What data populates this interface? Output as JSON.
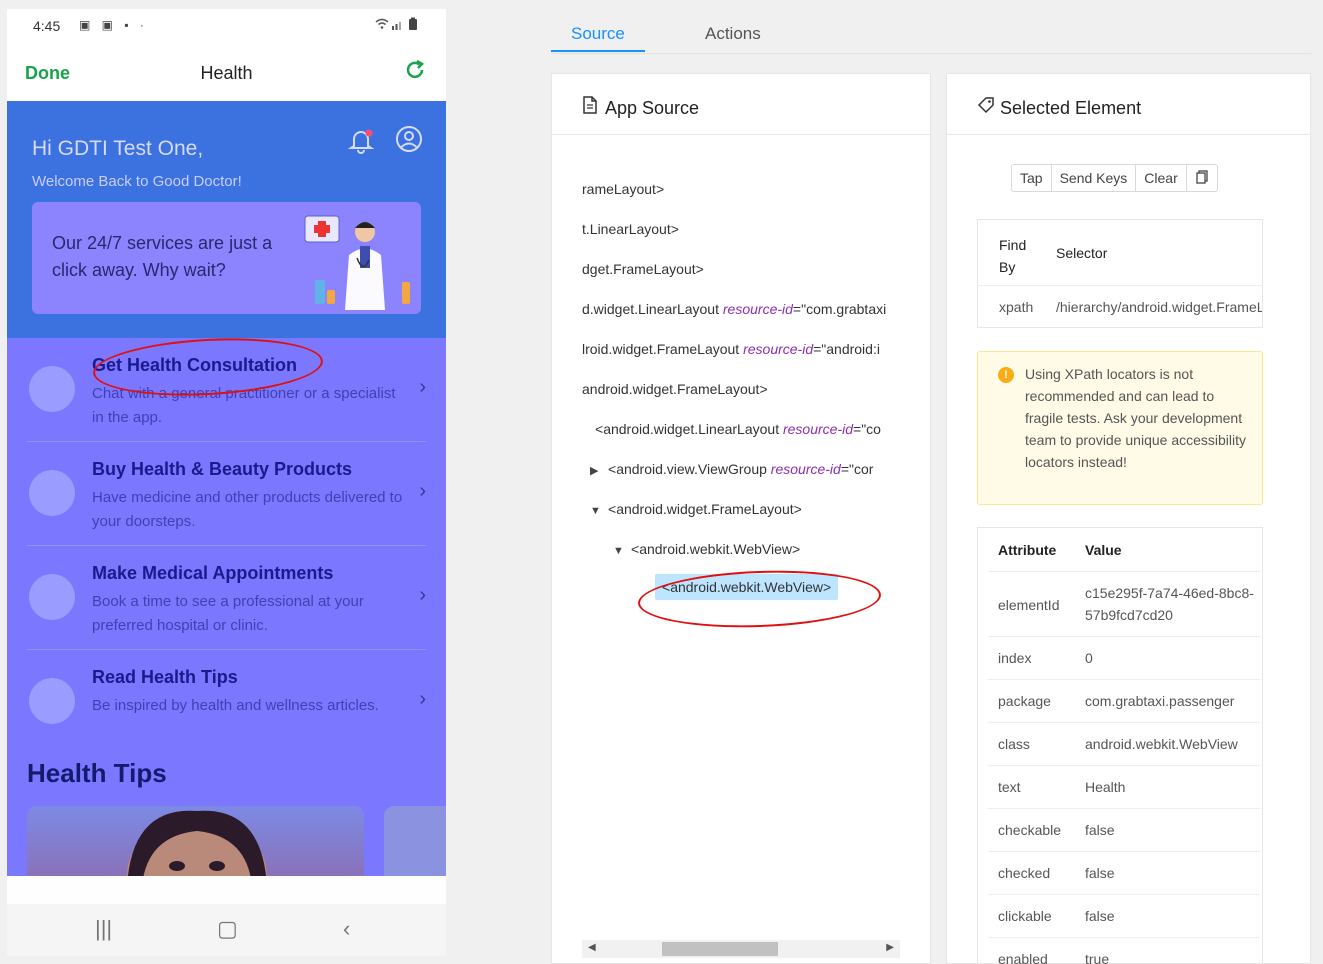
{
  "phone": {
    "status_time": "4:45",
    "nav": {
      "done": "Done",
      "title": "Health"
    },
    "hero": {
      "greeting": "Hi GDTI Test One,",
      "welcome": "Welcome Back to Good Doctor!",
      "promo": "Our 24/7 services are just a click away. Why wait?"
    },
    "services": [
      {
        "title": "Get Health Consultation",
        "desc": "Chat with a general practitioner or a specialist in the app."
      },
      {
        "title": "Buy Health & Beauty Products",
        "desc": "Have medicine and other products delivered to your doorsteps."
      },
      {
        "title": "Make Medical Appointments",
        "desc": "Book a time to see a professional at your preferred hospital or clinic."
      },
      {
        "title": "Read Health Tips",
        "desc": "Be inspired by health and wellness articles."
      }
    ],
    "health_tips_title": "Health Tips"
  },
  "inspector": {
    "tabs": [
      "Source",
      "Actions"
    ],
    "source_panel_title": "App Source",
    "tree": [
      {
        "tag": "<",
        "name": "rameLayout",
        "attr": "",
        "val": "",
        "close": ">"
      },
      {
        "tag": "",
        "name": "t.LinearLayout",
        "attr": "",
        "val": "",
        "close": ">"
      },
      {
        "tag": "",
        "name": "dget.FrameLayout",
        "attr": "",
        "val": "",
        "close": ">"
      },
      {
        "tag": "",
        "name": "d.widget.LinearLayout",
        "attr": "resource-id",
        "val": "=\"com.grabtaxi",
        "close": ""
      },
      {
        "tag": "",
        "name": "lroid.widget.FrameLayout",
        "attr": "resource-id",
        "val": "=\"android:i",
        "close": ""
      },
      {
        "tag": "",
        "name": "android.widget.FrameLayout",
        "attr": "",
        "val": "",
        "close": ">"
      },
      {
        "tag": "<",
        "name": "android.widget.LinearLayout",
        "attr": "resource-id",
        "val": "=\"co",
        "close": ""
      },
      {
        "tag": "<",
        "name": "android.view.ViewGroup",
        "attr": "resource-id",
        "val": "=\"cor",
        "close": ""
      },
      {
        "tag": "<",
        "name": "android.widget.FrameLayout",
        "attr": "",
        "val": "",
        "close": ">"
      },
      {
        "tag": "<",
        "name": "android.webkit.WebView",
        "attr": "",
        "val": "",
        "close": ">"
      },
      {
        "tag": "<",
        "name": "android.webkit.WebView",
        "attr": "",
        "val": "",
        "close": ">"
      }
    ],
    "selected_panel_title": "Selected Element",
    "actions": [
      "Tap",
      "Send Keys",
      "Clear"
    ],
    "selector": {
      "h1": "Find By",
      "h2": "Selector",
      "find_by": "xpath",
      "value": "/hierarchy/android.widget.FrameLay"
    },
    "warning": "Using XPath locators is not recommended and can lead to fragile tests. Ask your development team to provide unique accessibility locators instead!",
    "attributes_header": {
      "k": "Attribute",
      "v": "Value"
    },
    "attributes": [
      {
        "k": "elementId",
        "v": "c15e295f-7a74-46ed-8bc8-57b9fcd7cd20"
      },
      {
        "k": "index",
        "v": "0"
      },
      {
        "k": "package",
        "v": "com.grabtaxi.passenger"
      },
      {
        "k": "class",
        "v": "android.webkit.WebView"
      },
      {
        "k": "text",
        "v": "Health"
      },
      {
        "k": "checkable",
        "v": "false"
      },
      {
        "k": "checked",
        "v": "false"
      },
      {
        "k": "clickable",
        "v": "false"
      },
      {
        "k": "enabled",
        "v": "true"
      }
    ]
  }
}
